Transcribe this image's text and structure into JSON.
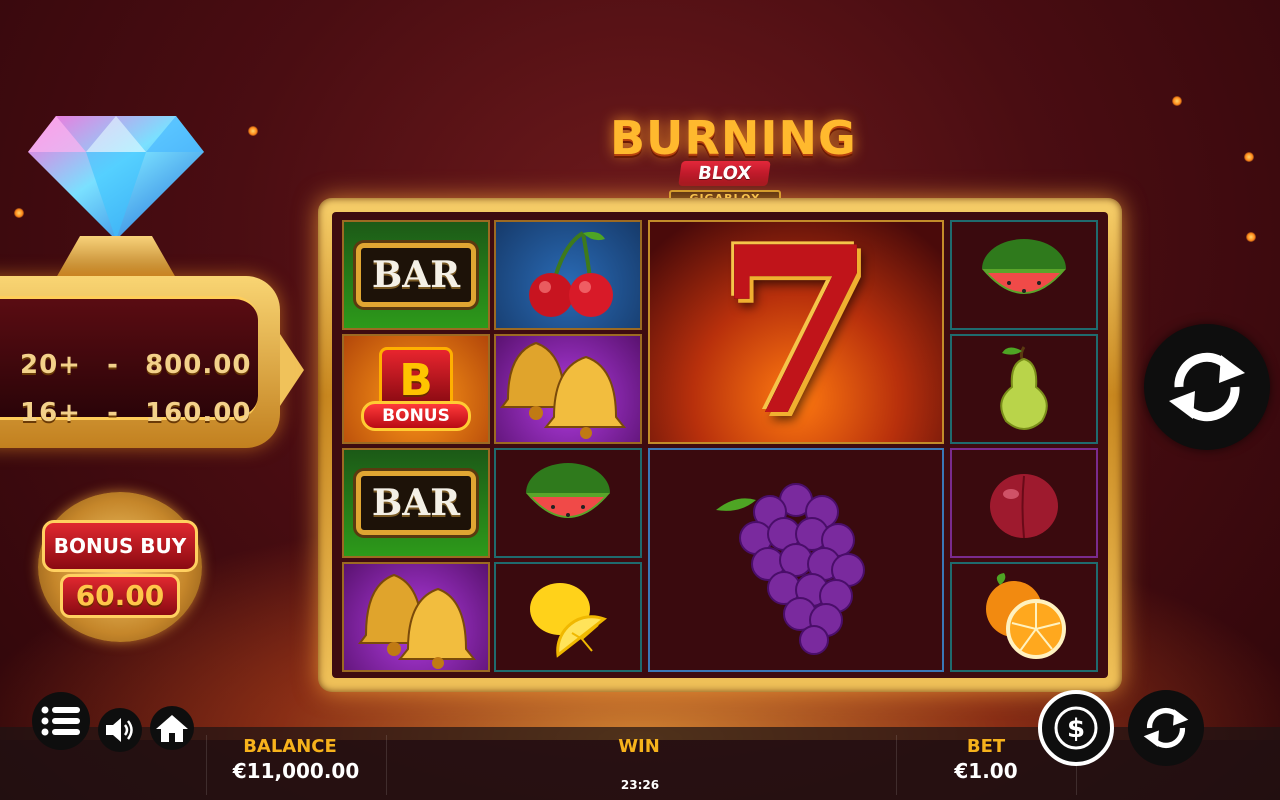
{
  "game": {
    "logo_title": "BURNING",
    "logo_ribbon": "BLOX",
    "logo_sub": "GIGABLOX"
  },
  "jackpot": {
    "rows": [
      {
        "count": "20+",
        "sep": "-",
        "value": "800.00"
      },
      {
        "count": "16+",
        "sep": "-",
        "value": "160.00"
      }
    ]
  },
  "bonus_buy": {
    "label": "BONUS BUY",
    "price": "60.00"
  },
  "reels": {
    "bar_text": "BAR",
    "bonus_letter": "B",
    "bonus_text": "BONUS",
    "seven_text": "7"
  },
  "footer": {
    "balance_label": "BALANCE",
    "balance_value": "€11,000.00",
    "win_label": "WIN",
    "bet_label": "BET",
    "bet_value": "€1.00",
    "clock": "23:26"
  },
  "icons": [
    "diamond-icon",
    "menu-icon",
    "sound-icon",
    "home-icon",
    "dollar-icon",
    "autoplay-icon",
    "spin-icon",
    "cherry-icon",
    "bell-icon",
    "watermelon-icon",
    "pear-icon",
    "grapes-icon",
    "plum-icon",
    "orange-icon",
    "lemon-icon"
  ],
  "colors": {
    "accent": "#f6b21c",
    "gold": "#f0c25a",
    "bg": "#4a0d12"
  }
}
